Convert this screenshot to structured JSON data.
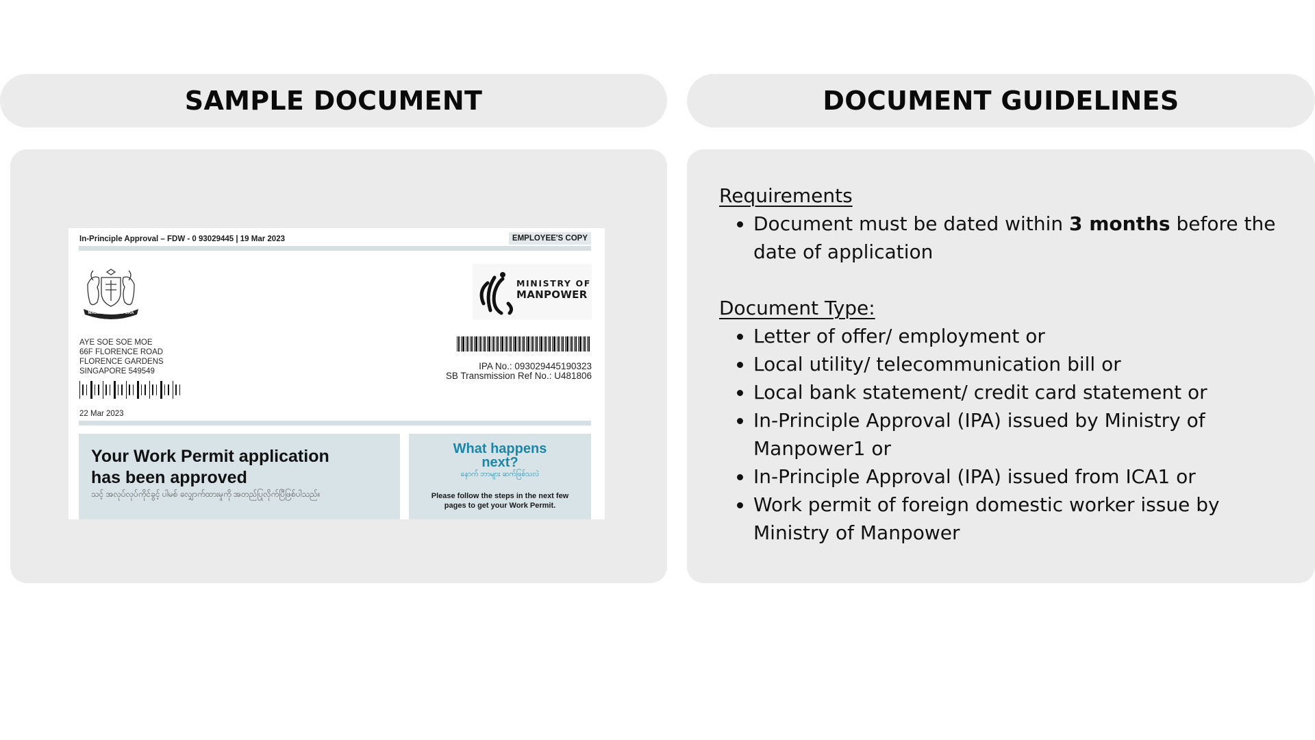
{
  "left_header": "SAMPLE DOCUMENT",
  "right_header": "DOCUMENT GUIDELINES",
  "sample_doc": {
    "top_line": "In-Principle Approval – FDW - 0 93029445 | 19 Mar 2023",
    "copy_badge": "EMPLOYEE'S COPY",
    "crest_caption": "MAJULAH SINGAPURA",
    "ministry_line1": "MINISTRY OF",
    "ministry_line2": "MANPOWER",
    "address": [
      "AYE SOE SOE MOE",
      "66F FLORENCE ROAD",
      "FLORENCE GARDENS",
      "SINGAPORE 549549"
    ],
    "ipa_no": "IPA No.: 093029445190323",
    "sb_ref": "SB Transmission Ref No.: U481806",
    "date": "22 Mar 2023",
    "approved_line1": "Your Work Permit application",
    "approved_line2": "has been approved",
    "approved_burmese": "သင့် အလုပ်လုပ်ကိုင်ခွင့် ပါမစ် လျှောက်ထားမှုကို အတည်ပြုလိုက်ပြီဖြစ်ပါသည်။",
    "next_line1": "What happens",
    "next_line2": "next?",
    "next_burmese": "နောက် ဘာများ ဆက်ဖြစ်သလဲ",
    "next_body": "Please follow the steps in the next few pages to get your Work Permit."
  },
  "guidelines": {
    "requirements_heading": "Requirements",
    "req_pre": "Document must be dated within ",
    "req_bold": "3 months",
    "req_post": " before the date of application",
    "type_heading": "Document Type:",
    "types": [
      "Letter of offer/ employment or",
      "Local utility/ telecommunication bill or",
      "Local bank statement/ credit card statement or",
      "In-Principle Approval (IPA) issued by Ministry of Manpower1 or",
      "In-Principle Approval (IPA) issued from ICA1 or",
      "Work permit of foreign domestic worker issue by Ministry of Manpower"
    ]
  }
}
